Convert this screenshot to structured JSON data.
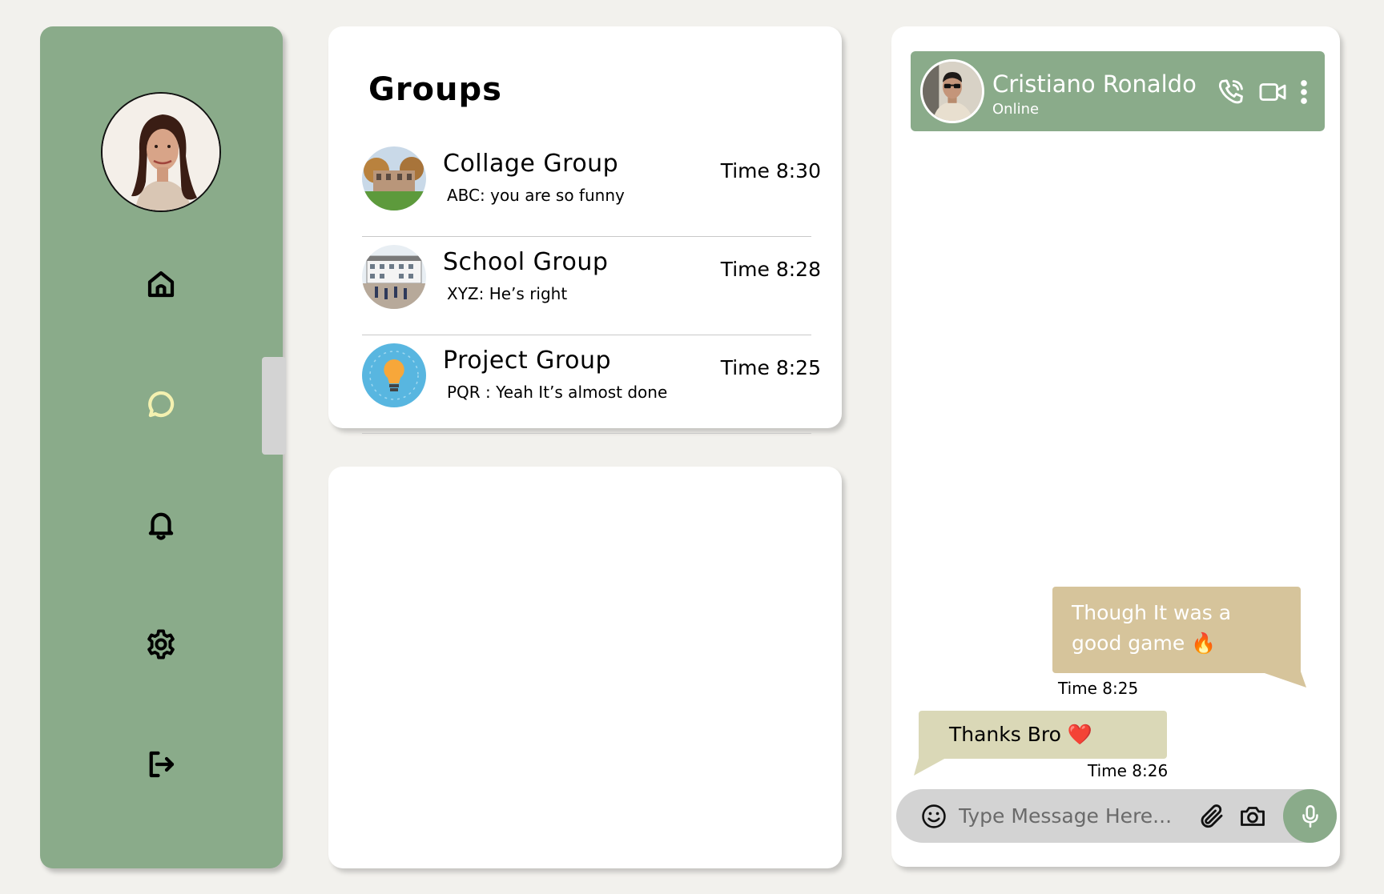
{
  "sidebar": {
    "nav": [
      {
        "icon": "home-icon"
      },
      {
        "icon": "chat-icon",
        "active": true
      },
      {
        "icon": "bell-icon"
      },
      {
        "icon": "gear-icon"
      },
      {
        "icon": "logout-icon"
      }
    ]
  },
  "groups": {
    "title": "Groups",
    "items": [
      {
        "name": "Collage Group",
        "preview": "ABC:  you are so funny",
        "time": "Time 8:30"
      },
      {
        "name": "School Group",
        "preview": "XYZ:  He’s right",
        "time": "Time 8:28"
      },
      {
        "name": "Project Group",
        "preview": "PQR :  Yeah It’s almost done",
        "time": "Time 8:25"
      }
    ]
  },
  "chat": {
    "contact_name": "Cristiano Ronaldo",
    "contact_status": "Online",
    "messages": [
      {
        "direction": "outgoing",
        "text": "Though It was a good game 🔥",
        "time": "Time 8:25"
      },
      {
        "direction": "incoming",
        "text": "Thanks Bro ❤️",
        "time": "Time 8:26"
      }
    ],
    "input_placeholder": "Type Message Here..."
  },
  "colors": {
    "accent": "#8aab8a",
    "outgoing_bubble": "#d6c49b",
    "incoming_bubble": "#dad8b7",
    "active_nav": "#f4f1b0",
    "background": "#f2f1ed"
  }
}
